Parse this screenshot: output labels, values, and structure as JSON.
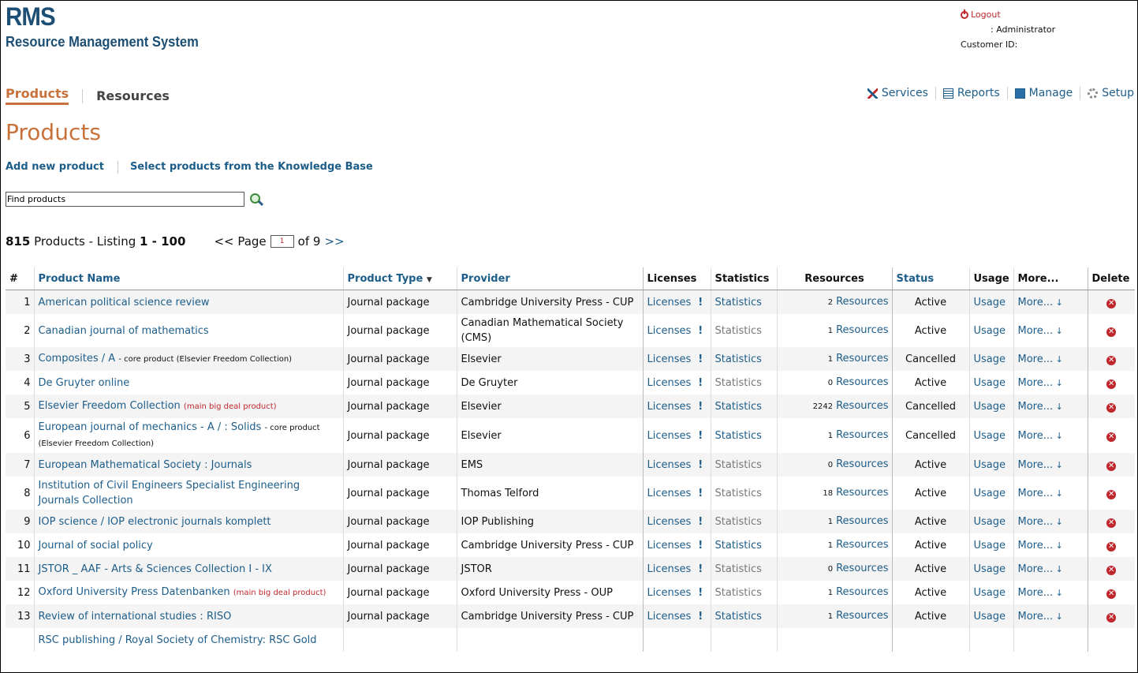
{
  "app": {
    "logo_short": "RMS",
    "logo_full": "Resource Management System",
    "logout": "Logout",
    "user": ": Administrator",
    "customer_id": "Customer ID:"
  },
  "tabs": [
    {
      "label": "Products",
      "active": true
    },
    {
      "label": "Resources",
      "active": false
    }
  ],
  "topnav": [
    {
      "label": "Services",
      "icon": "services-icon"
    },
    {
      "label": "Reports",
      "icon": "reports-icon"
    },
    {
      "label": "Manage",
      "icon": "manage-icon"
    },
    {
      "label": "Setup",
      "icon": "gear-icon"
    }
  ],
  "page_title": "Products",
  "actions": {
    "add": "Add new product",
    "select_kb": "Select products from the Knowledge Base"
  },
  "search": {
    "value": "Find products"
  },
  "listing": {
    "total": "815",
    "products_label": "Products - Listing",
    "range": "1 - 100",
    "page_prefix": "<< Page",
    "page_value": "1",
    "of_label": "of 9",
    "next": ">>"
  },
  "columns": {
    "num": "#",
    "name": "Product Name",
    "type": "Product Type",
    "provider": "Provider",
    "licenses": "Licenses",
    "statistics": "Statistics",
    "resources": "Resources",
    "status": "Status",
    "usage": "Usage",
    "more": "More...",
    "delete": "Delete"
  },
  "row_labels": {
    "licenses": "Licenses",
    "bang": "!",
    "statistics": "Statistics",
    "resources": "Resources",
    "usage": "Usage",
    "more": "More...",
    "delete": "✕"
  },
  "colors": {
    "accent": "#c8713a",
    "link": "#1d5d8a",
    "danger": "#c0272d"
  },
  "rows": [
    {
      "n": "1",
      "name": "American political science review",
      "note": "",
      "note_type": "",
      "type": "Journal package",
      "provider": "Cambridge University Press - CUP",
      "stats_link": true,
      "res_count": "2",
      "status": "Active"
    },
    {
      "n": "2",
      "name": "Canadian journal of mathematics",
      "note": "",
      "note_type": "",
      "type": "Journal package",
      "provider": "Canadian Mathematical Society (CMS)",
      "stats_link": false,
      "res_count": "1",
      "status": "Active"
    },
    {
      "n": "3",
      "name": "Composites / A",
      "note": "- core product (Elsevier Freedom Collection)",
      "note_type": "core",
      "type": "Journal package",
      "provider": "Elsevier",
      "stats_link": true,
      "res_count": "1",
      "status": "Cancelled"
    },
    {
      "n": "4",
      "name": "De Gruyter online",
      "note": "",
      "note_type": "",
      "type": "Journal package",
      "provider": "De Gruyter",
      "stats_link": false,
      "res_count": "0",
      "status": "Active"
    },
    {
      "n": "5",
      "name": "Elsevier Freedom Collection",
      "note": "(main big deal product)",
      "note_type": "main",
      "type": "Journal package",
      "provider": "Elsevier",
      "stats_link": true,
      "res_count": "2242",
      "status": "Cancelled"
    },
    {
      "n": "6",
      "name": "European journal of mechanics - A / : Solids",
      "note": "- core product (Elsevier Freedom Collection)",
      "note_type": "core",
      "type": "Journal package",
      "provider": "Elsevier",
      "stats_link": true,
      "res_count": "1",
      "status": "Cancelled"
    },
    {
      "n": "7",
      "name": "European Mathematical Society : Journals",
      "note": "",
      "note_type": "",
      "type": "Journal package",
      "provider": "EMS",
      "stats_link": false,
      "res_count": "0",
      "status": "Active"
    },
    {
      "n": "8",
      "name": "Institution of Civil Engineers Specialist Engineering Journals Collection",
      "note": "",
      "note_type": "",
      "type": "Journal package",
      "provider": "Thomas Telford",
      "stats_link": false,
      "res_count": "18",
      "status": "Active"
    },
    {
      "n": "9",
      "name": "IOP science / IOP electronic journals komplett",
      "note": "",
      "note_type": "",
      "type": "Journal package",
      "provider": "IOP Publishing",
      "stats_link": false,
      "res_count": "1",
      "status": "Active"
    },
    {
      "n": "10",
      "name": "Journal of social policy",
      "note": "",
      "note_type": "",
      "type": "Journal package",
      "provider": "Cambridge University Press - CUP",
      "stats_link": true,
      "res_count": "1",
      "status": "Active"
    },
    {
      "n": "11",
      "name": "JSTOR _ AAF - Arts & Sciences Collection I - IX",
      "note": "",
      "note_type": "",
      "type": "Journal package",
      "provider": "JSTOR",
      "stats_link": false,
      "res_count": "0",
      "status": "Active"
    },
    {
      "n": "12",
      "name": "Oxford University Press Datenbanken",
      "note": "(main big deal product)",
      "note_type": "main",
      "type": "Journal package",
      "provider": "Oxford University Press - OUP",
      "stats_link": false,
      "res_count": "1",
      "status": "Active"
    },
    {
      "n": "13",
      "name": "Review of international studies : RISO",
      "note": "",
      "note_type": "",
      "type": "Journal package",
      "provider": "Cambridge University Press - CUP",
      "stats_link": true,
      "res_count": "1",
      "status": "Active"
    },
    {
      "n": "",
      "name": "RSC publishing / Royal Society of Chemistry: RSC Gold",
      "note": "",
      "note_type": "",
      "type": "",
      "provider": "",
      "stats_link": false,
      "res_count": "",
      "status": "",
      "partial": true
    }
  ]
}
